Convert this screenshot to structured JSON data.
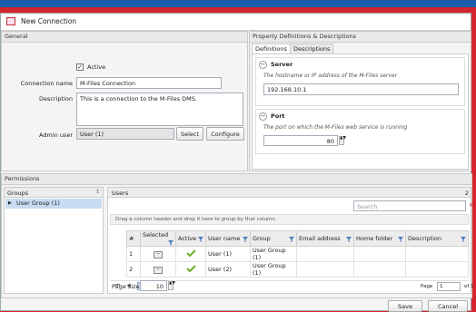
{
  "window": {
    "title": "New Connection"
  },
  "general": {
    "header": "General",
    "active_label": "Active",
    "active_checked": true,
    "connection_name_label": "Connection name",
    "connection_name_value": "M-Files Connection",
    "description_label": "Description",
    "description_value": "This is a connection to the M-Files DMS.",
    "admin_user_label": "Admin user",
    "admin_user_value": "User (1)",
    "select_label": "Select",
    "configure_label": "Configure"
  },
  "property": {
    "header": "Property Definitions & Descriptions",
    "tabs": [
      {
        "label": "Definitions"
      },
      {
        "label": "Descriptions"
      }
    ],
    "server": {
      "title": "Server",
      "hint": "The hostname or IP address of the M-Files server",
      "value": "192.168.10.1"
    },
    "port": {
      "title": "Port",
      "hint": "The port on which the M-Files web service is running",
      "value": "80"
    }
  },
  "permissions": {
    "header": "Permissions",
    "groups": {
      "header": "Groups",
      "sort_glyph": "↕",
      "items": [
        {
          "label": "User Group (1)"
        }
      ]
    },
    "users": {
      "header": "Users",
      "corner_digit": "2",
      "search_placeholder": "Search",
      "clear_glyph": "✕",
      "drag_hint": "Drag a column header and drop it here to group by that column",
      "columns": [
        "#",
        "Selected",
        "Active",
        "User name",
        "Group",
        "Email address",
        "Home folder",
        "Description"
      ],
      "rows": [
        {
          "num": "1",
          "user": "User (1)",
          "group": "User Group (1)"
        },
        {
          "num": "2",
          "user": "User (2)",
          "group": "User Group (1)"
        }
      ],
      "current_page": "1",
      "page_label": "Page",
      "page_value": "1",
      "of_label": "of 1",
      "page_size_label": "Page size",
      "page_size_value": "10"
    }
  },
  "footer": {
    "save_label": "Save",
    "cancel_label": "Cancel"
  }
}
